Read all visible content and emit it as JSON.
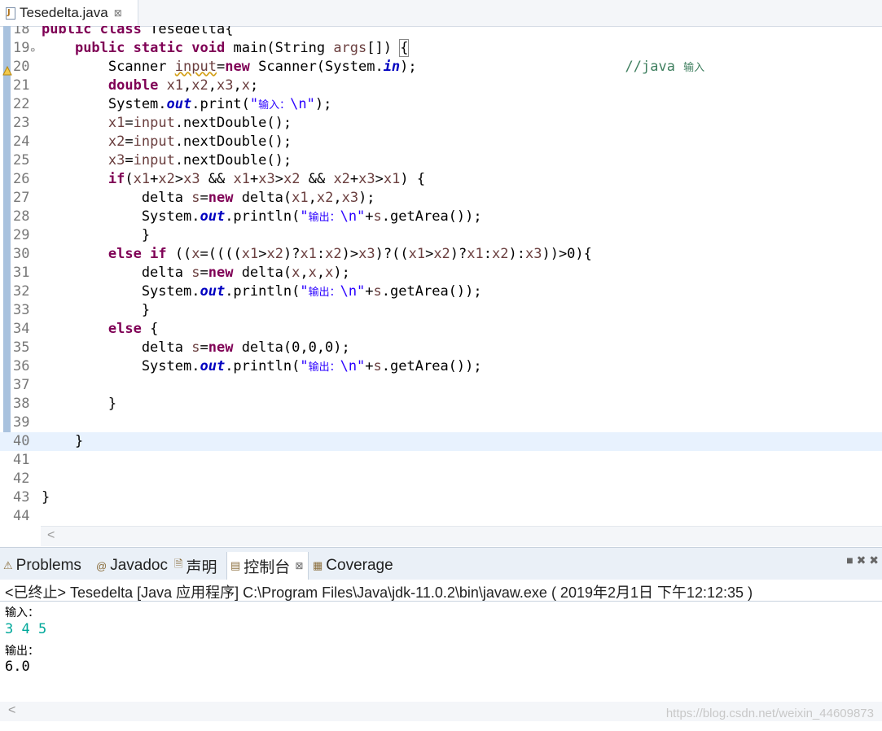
{
  "editor": {
    "tab_label": "Tesedelta.java",
    "tab_close": "⊠"
  },
  "lines": [
    {
      "n": "18",
      "html": "<span class=\"k\">public</span> <span class=\"k\">class</span> Tesedelta{"
    },
    {
      "n": "19",
      "html": "    <span class=\"k\">public</span> <span class=\"k\">static</span> <span class=\"k\">void</span> main(String <span class=\"v\">args</span>[]) <span class=\"br\">{</span>",
      "fold": true
    },
    {
      "n": "20",
      "html": "        Scanner <span class=\"v warn\">input</span>=<span class=\"k\">new</span> Scanner(System.<span class=\"f\">in</span>);                         <span class=\"c\">//java <span class=\"cn\">输入</span></span>",
      "marker": true
    },
    {
      "n": "21",
      "html": "        <span class=\"k\">double</span> <span class=\"v\">x1</span>,<span class=\"v\">x2</span>,<span class=\"v\">x3</span>,<span class=\"v\">x</span>;"
    },
    {
      "n": "22",
      "html": "        System.<span class=\"f\">out</span>.print(<span class=\"s\">\"<span class=\"cn\">输入：</span>\\n\"</span>);"
    },
    {
      "n": "23",
      "html": "        <span class=\"v\">x1</span>=<span class=\"v\">input</span>.nextDouble();"
    },
    {
      "n": "24",
      "html": "        <span class=\"v\">x2</span>=<span class=\"v\">input</span>.nextDouble();"
    },
    {
      "n": "25",
      "html": "        <span class=\"v\">x3</span>=<span class=\"v\">input</span>.nextDouble();"
    },
    {
      "n": "26",
      "html": "        <span class=\"k\">if</span>(<span class=\"v\">x1</span>+<span class=\"v\">x2</span>&gt;<span class=\"v\">x3</span> &amp;&amp; <span class=\"v\">x1</span>+<span class=\"v\">x3</span>&gt;<span class=\"v\">x2</span> &amp;&amp; <span class=\"v\">x2</span>+<span class=\"v\">x3</span>&gt;<span class=\"v\">x1</span>) {"
    },
    {
      "n": "27",
      "html": "            delta <span class=\"v\">s</span>=<span class=\"k\">new</span> delta(<span class=\"v\">x1</span>,<span class=\"v\">x2</span>,<span class=\"v\">x3</span>);"
    },
    {
      "n": "28",
      "html": "            System.<span class=\"f\">out</span>.println(<span class=\"s\">\"<span class=\"cn\">输出：</span>\\n\"</span>+<span class=\"v\">s</span>.getArea());"
    },
    {
      "n": "29",
      "html": "            }"
    },
    {
      "n": "30",
      "html": "        <span class=\"k\">else</span> <span class=\"k\">if</span> ((<span class=\"v\">x</span>=((((<span class=\"v\">x1</span>&gt;<span class=\"v\">x2</span>)?<span class=\"v\">x1</span>:<span class=\"v\">x2</span>)&gt;<span class=\"v\">x3</span>)?((<span class=\"v\">x1</span>&gt;<span class=\"v\">x2</span>)?<span class=\"v\">x1</span>:<span class=\"v\">x2</span>):<span class=\"v\">x3</span>))&gt;0){"
    },
    {
      "n": "31",
      "html": "            delta <span class=\"v\">s</span>=<span class=\"k\">new</span> delta(<span class=\"v\">x</span>,<span class=\"v\">x</span>,<span class=\"v\">x</span>);"
    },
    {
      "n": "32",
      "html": "            System.<span class=\"f\">out</span>.println(<span class=\"s\">\"<span class=\"cn\">输出：</span>\\n\"</span>+<span class=\"v\">s</span>.getArea());"
    },
    {
      "n": "33",
      "html": "            }"
    },
    {
      "n": "34",
      "html": "        <span class=\"k\">else</span> {"
    },
    {
      "n": "35",
      "html": "            delta <span class=\"v\">s</span>=<span class=\"k\">new</span> delta(0,0,0);"
    },
    {
      "n": "36",
      "html": "            System.<span class=\"f\">out</span>.println(<span class=\"s\">\"<span class=\"cn\">输出：</span>\\n\"</span>+<span class=\"v\">s</span>.getArea());"
    },
    {
      "n": "37",
      "html": ""
    },
    {
      "n": "38",
      "html": "        }"
    },
    {
      "n": "39",
      "html": ""
    },
    {
      "n": "40",
      "html": "    }",
      "hl": true
    },
    {
      "n": "41",
      "html": ""
    },
    {
      "n": "42",
      "html": ""
    },
    {
      "n": "43",
      "html": "}"
    },
    {
      "n": "44",
      "html": ""
    }
  ],
  "console": {
    "tabs": [
      {
        "label": "Problems",
        "icon": "problems-icon",
        "glyph": "⚠"
      },
      {
        "label": "Javadoc",
        "icon": "javadoc-icon",
        "glyph": "@"
      },
      {
        "label": "声明",
        "icon": "declaration-icon",
        "glyph": "🗎"
      },
      {
        "label": "控制台",
        "icon": "console-icon",
        "glyph": "▤",
        "active": true
      },
      {
        "label": "Coverage",
        "icon": "coverage-icon",
        "glyph": "▦"
      }
    ],
    "tab_close": "⊠",
    "actions": "■ ✖ ✖",
    "status": "<已终止> Tesedelta [Java 应用程序] C:\\Program Files\\Java\\jdk-11.0.2\\bin\\javaw.exe ( 2019年2月1日 下午12:12:35 )",
    "output": {
      "prompt_in": "输入：",
      "user_input": "3 4 5",
      "prompt_out": "输出：",
      "result": "6.0"
    },
    "watermark": "https://blog.csdn.net/weixin_44609873"
  }
}
